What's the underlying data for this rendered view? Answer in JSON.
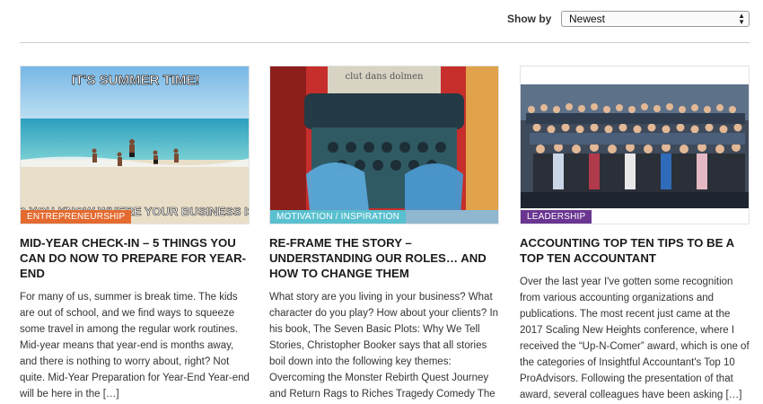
{
  "toolbar": {
    "show_by_label": "Show by",
    "sort_select": {
      "selected": "Newest"
    }
  },
  "colors": {
    "entrepreneurship": "#e46a2f",
    "motivation": "#59c0cf",
    "leadership": "#6a3591",
    "divider": "#cfcfcf"
  },
  "posts": [
    {
      "image_caption_top": "IT'S SUMMER TIME!",
      "image_caption_bottom": "DO YOU KNOW WHERE YOUR BUSINESS IS?",
      "category": "ENTREPRENEURSHIP",
      "title": "MID-YEAR CHECK-IN – 5 THINGS YOU CAN DO NOW TO PREPARE FOR YEAR-END",
      "excerpt": "For many of us, summer is break time. The kids are out of school, and we find ways to squeeze some travel in among the regular work routines. Mid-year means that year-end is months away, and there is nothing to worry about, right? Not quite. Mid-Year Preparation for Year-End Year-end will be here in the […]"
    },
    {
      "image_caption_top": "clut dans dolmen",
      "category": "MOTIVATION / INSPIRATION",
      "title": "RE-FRAME THE STORY – UNDERSTANDING OUR ROLES… AND HOW TO CHANGE THEM",
      "excerpt": "What story are you living in your business? What character do you play? How about your clients? In his book, The Seven Basic Plots: Why We Tell Stories, Christopher Booker says that all stories boil down into the following key themes: Overcoming the Monster Rebirth Quest Journey and Return Rags to Riches Tragedy Comedy The […]"
    },
    {
      "category": "LEADERSHIP",
      "title": "ACCOUNTING TOP TEN TIPS TO BE A TOP TEN ACCOUNTANT",
      "excerpt": "Over the last year I've gotten some recognition from various accounting organizations and publications. The most recent just came at the 2017 Scaling New Heights conference, where I received the “Up-N-Comer” award, which is one of the categories of Insightful Accountant's Top 10 ProAdvisors. Following the presentation of that award, several colleagues have been asking […]"
    }
  ]
}
